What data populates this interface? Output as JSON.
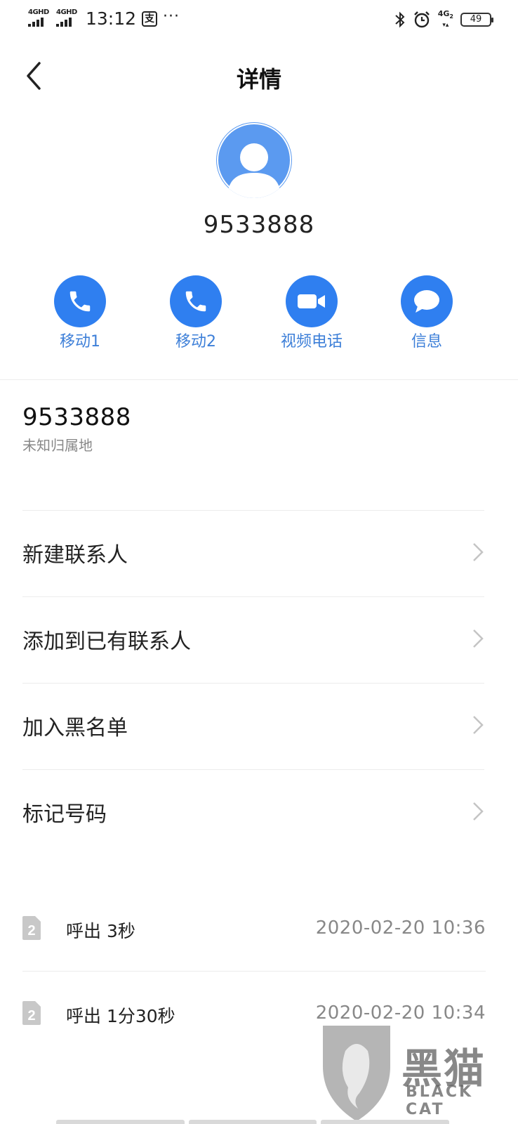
{
  "status_bar": {
    "network1": "4GHD",
    "network2": "4GHD",
    "time": "13:12",
    "alipay_icon": "支",
    "more": "···",
    "net_small": "4G",
    "net_small_sub": "2",
    "battery": "49"
  },
  "header": {
    "title": "详情"
  },
  "contact": {
    "number": "9533888"
  },
  "actions": [
    {
      "label": "移动1",
      "icon": "phone-icon"
    },
    {
      "label": "移动2",
      "icon": "phone-icon"
    },
    {
      "label": "视频电话",
      "icon": "video-icon"
    },
    {
      "label": "信息",
      "icon": "message-icon"
    }
  ],
  "number_detail": {
    "number": "9533888",
    "location": "未知归属地"
  },
  "menu": [
    {
      "label": "新建联系人"
    },
    {
      "label": "添加到已有联系人"
    },
    {
      "label": "加入黑名单"
    },
    {
      "label": "标记号码"
    }
  ],
  "calls": [
    {
      "sim": "2",
      "desc": "呼出 3秒",
      "time": "2020-02-20 10:36"
    },
    {
      "sim": "2",
      "desc": "呼出 1分30秒",
      "time": "2020-02-20 10:34"
    }
  ],
  "watermark": {
    "text": "黑猫",
    "sub": "BLACK CAT"
  },
  "colors": {
    "accent": "#2f7ff0",
    "label_blue": "#3d7fd8",
    "avatar": "#5b9af0"
  }
}
